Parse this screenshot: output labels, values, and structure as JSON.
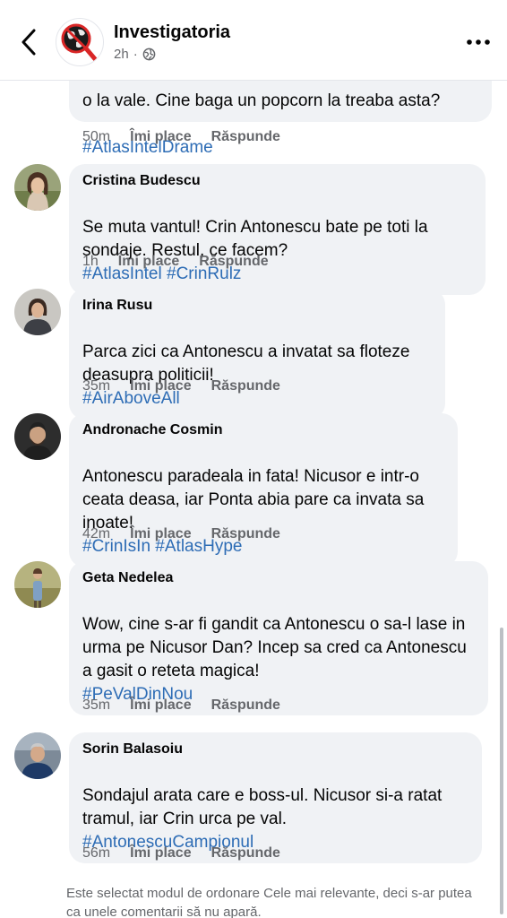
{
  "header": {
    "page_name": "Investigatoria",
    "post_time": "2h",
    "separator": "·",
    "audience_icon": "globe-icon",
    "back_icon": "chevron-left-icon",
    "more_icon": "more-dots-icon"
  },
  "partial_comment": {
    "text_tail": "o la vale. Cine baga un popcorn la treaba asta?",
    "hashtag": "#AtlasIntelDrame",
    "time": "50m",
    "like_label": "Îmi place",
    "reply_label": "Răspunde"
  },
  "comments": [
    {
      "author": "Cristina Budescu",
      "text": "Se muta vantul! Crin Antonescu bate pe toti la sondaje. Restul, ce facem?",
      "hashtags": "#AtlasIntel #CrinRulz",
      "time": "1h",
      "like_label": "Îmi place",
      "reply_label": "Răspunde"
    },
    {
      "author": "Irina Rusu",
      "text": "Parca zici ca Antonescu a invatat sa floteze deasupra politicii!",
      "hashtags": "#AirAboveAll",
      "time": "35m",
      "like_label": "Îmi place",
      "reply_label": "Răspunde"
    },
    {
      "author": "Andronache Cosmin",
      "text": "Antonescu paradeala in fata! Nicusor e intr-o ceata deasa, iar Ponta abia pare ca invata sa inoate!",
      "hashtags": "#CrinIsIn #AtlasHype",
      "time": "42m",
      "like_label": "Îmi place",
      "reply_label": "Răspunde"
    },
    {
      "author": "Geta Nedelea",
      "text": "Wow, cine s-ar fi gandit ca Antonescu o sa-l lase in urma pe Nicusor Dan? Incep sa cred ca Antonescu a gasit o reteta magica!",
      "hashtags": "#PeValDinNou",
      "time": "35m",
      "like_label": "Îmi place",
      "reply_label": "Răspunde"
    },
    {
      "author": "Sorin Balasoiu",
      "text": "Sondajul arata care e boss-ul. Nicusor si-a ratat tramul, iar Crin urca pe val.",
      "hashtags": "#AntonescuCampionul",
      "time": "56m",
      "like_label": "Îmi place",
      "reply_label": "Răspunde"
    }
  ],
  "footer_note": "Este selectat modul de ordonare Cele mai relevante, deci s-ar putea ca unele comentarii să nu apară.",
  "colors": {
    "hashtag": "#2d6cb5",
    "bubble": "#f0f2f5",
    "muted": "#65676b"
  }
}
